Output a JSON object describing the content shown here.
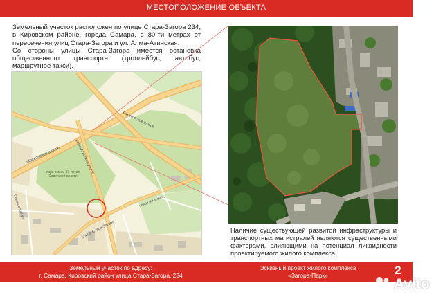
{
  "header": {
    "title": "МЕСТОПОЛОЖЕНИЕ ОБЪЕКТА"
  },
  "description": {
    "p1": "Земельный участок расположен по улице Стара-Загора 234, в Кировском районе, города Самара, в 80-ти метрах от пересечения улиц Стара-Загора и ул. Алма-Атинская.",
    "p2": "Со стороны улицы Стара-Загора имеется остановка общественного транспорта (троллейбус, автобус, маршрутное такси)."
  },
  "map": {
    "street_moskovskoe": "Московское шоссе",
    "street_rakitovskoe": "Ракитовское шоссе",
    "street_almaatinskaya": "Алма-Атинская улица",
    "street_staragora": "улица Стара-Загора",
    "street_lesnaya": "Гашековская ул",
    "park_label": "парк имени 50-летия Советской власти",
    "street_svobody": "улица Фадеева"
  },
  "caption": {
    "text": "Наличие существующей развитой инфраструктуры и транспортных магистралей являются существенными факторами, влияющими на потенциал ликвидности проектируемого жилого комплекса."
  },
  "footer": {
    "address_line1": "Земельный участок по адресу:",
    "address_line2": "г. Самара, Кировский район улица Стара-Загора, 234",
    "project_line1": "Эскизный проект жилого комплекса",
    "project_line2": "«Загора-Парк»",
    "page_number": "2"
  },
  "watermark": {
    "text": "Avito"
  },
  "colors": {
    "brand_red": "#d92a23",
    "plot_outline": "#e8553f"
  }
}
